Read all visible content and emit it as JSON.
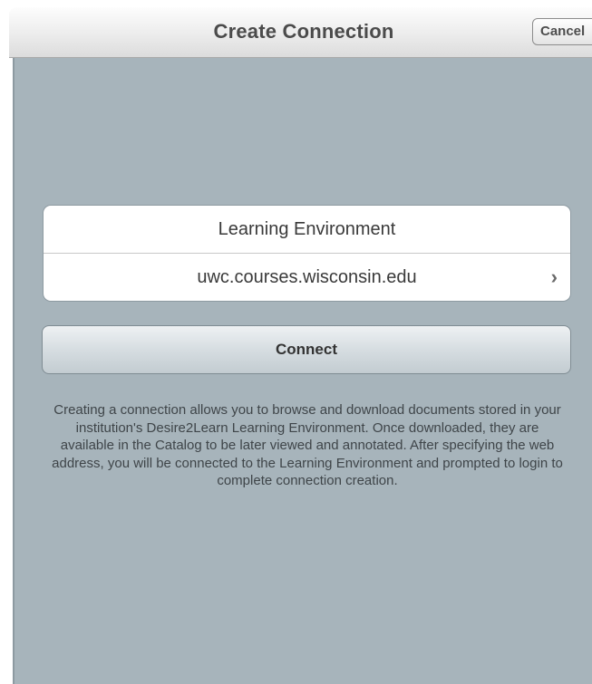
{
  "navbar": {
    "title": "Create Connection",
    "cancel_label": "Cancel"
  },
  "connection_form": {
    "section_title": "Learning Environment",
    "server_address": "uwc.courses.wisconsin.edu",
    "chevron_icon": "chevron-right-icon",
    "connect_label": "Connect"
  },
  "description": "Creating a connection allows you to browse and download documents stored in your institution's Desire2Learn Learning Environment. Once downloaded, they are available in the Catalog to be later viewed and annotated. After specifying the web address, you will be connected to the Learning Environment and prompted to login to complete connection creation.",
  "colors": {
    "panel_background": "#a7b4bb",
    "navbar_gradient_top": "#fdfdfd",
    "navbar_gradient_bottom": "#dcdcdc",
    "text_dark": "#3a3a3a"
  }
}
